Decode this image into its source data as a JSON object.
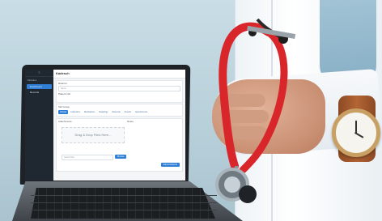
{
  "laptop_screen": {
    "app_title": "Kadesch",
    "sidebar": {
      "top_glyph": "≡",
      "section_label": "Modules",
      "items": [
        {
          "label": "Dashboard",
          "active": true
        },
        {
          "label": "Records",
          "active": false
        }
      ]
    },
    "form": {
      "section1_label": "Referrer",
      "section1_placeholder": "Name",
      "section2_label": "Patient Info",
      "checkbox1": "Auto complete",
      "checkbox2": "Referral sender",
      "section3_label": "Tab Group",
      "tabs": [
        "Clinical",
        "Laboratory",
        "Medications",
        "Radiology",
        "Referrals",
        "Results",
        "Appointments"
      ],
      "attachments_label": "Attachments",
      "notes_label": "Notes",
      "dropzone_text": "Drag & Drop Files Here...",
      "select_button": "Browse",
      "footer_placeholder": "Select Files",
      "submit_button": "Submit Referral"
    }
  },
  "colors": {
    "accent": "#2f7fd6",
    "background": "#b7cfd9",
    "stethoscope": "#d8262b",
    "watch_strap": "#b36434"
  }
}
